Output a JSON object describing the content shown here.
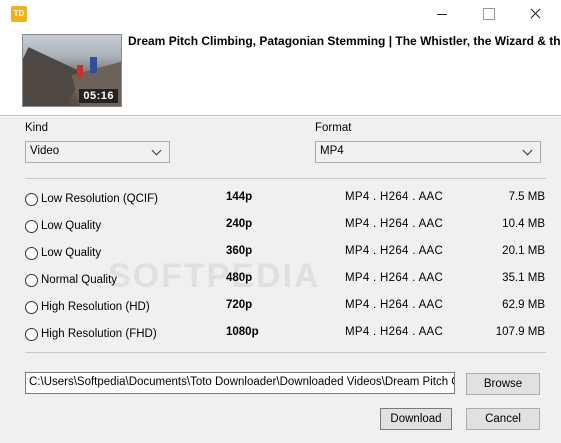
{
  "window": {
    "app_icon": "toto-app-icon",
    "controls": [
      "minimize-icon",
      "maximize-icon",
      "close-icon"
    ]
  },
  "video": {
    "title": "Dream Pitch Climbing, Patagonian Stemming | The Whistler, the Wizard & the",
    "duration": "05:16"
  },
  "kind": {
    "label": "Kind",
    "value": "Video"
  },
  "format": {
    "label": "Format",
    "value": "MP4"
  },
  "watermark": "SOFTPEDIA",
  "qualities": [
    {
      "label": "Low Resolution (QCIF)",
      "resolution": "144p",
      "format": "MP4 . H264 . AAC",
      "size": "7.5 MB"
    },
    {
      "label": "Low Quality",
      "resolution": "240p",
      "format": "MP4 . H264 . AAC",
      "size": "10.4 MB"
    },
    {
      "label": "Low Quality",
      "resolution": "360p",
      "format": "MP4 . H264 . AAC",
      "size": "20.1 MB"
    },
    {
      "label": "Normal Quality",
      "resolution": "480p",
      "format": "MP4 . H264 . AAC",
      "size": "35.1 MB"
    },
    {
      "label": "High Resolution (HD)",
      "resolution": "720p",
      "format": "MP4 . H264 . AAC",
      "size": "62.9 MB"
    },
    {
      "label": "High Resolution (FHD)",
      "resolution": "1080p",
      "format": "MP4 . H264 . AAC",
      "size": "107.9 MB"
    }
  ],
  "output": {
    "path": "C:\\Users\\Softpedia\\Documents\\Toto Downloader\\Downloaded Videos\\Dream Pitch Climbi",
    "browse_label": "Browse"
  },
  "actions": {
    "download_label": "Download",
    "cancel_label": "Cancel"
  }
}
